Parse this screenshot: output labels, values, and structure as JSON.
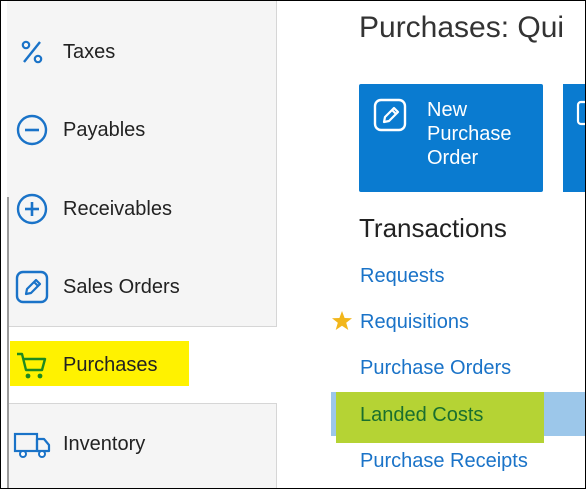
{
  "sidebar": {
    "items": [
      {
        "label": "Taxes",
        "icon": "percent-icon"
      },
      {
        "label": "Payables",
        "icon": "minus-circle-icon"
      },
      {
        "label": "Receivables",
        "icon": "plus-circle-icon"
      },
      {
        "label": "Sales Orders",
        "icon": "pencil-square-icon"
      },
      {
        "label": "Purchases",
        "icon": "cart-icon"
      },
      {
        "label": "Inventory",
        "icon": "truck-icon"
      }
    ]
  },
  "main": {
    "title": "Purchases: Qui",
    "tile": {
      "label": "New Purchase Order",
      "icon": "edit-icon"
    },
    "section_title": "Transactions",
    "links": [
      "Requests",
      "Requisitions",
      "Purchase Orders",
      "Landed Costs",
      "Purchase Receipts"
    ]
  },
  "colors": {
    "accent": "#0a7bd0",
    "link": "#1a73c8",
    "highlight_yellow": "#fff200",
    "highlight_green": "#b5d334",
    "icon_green": "#1f8a1f",
    "star": "#f2b61b"
  }
}
